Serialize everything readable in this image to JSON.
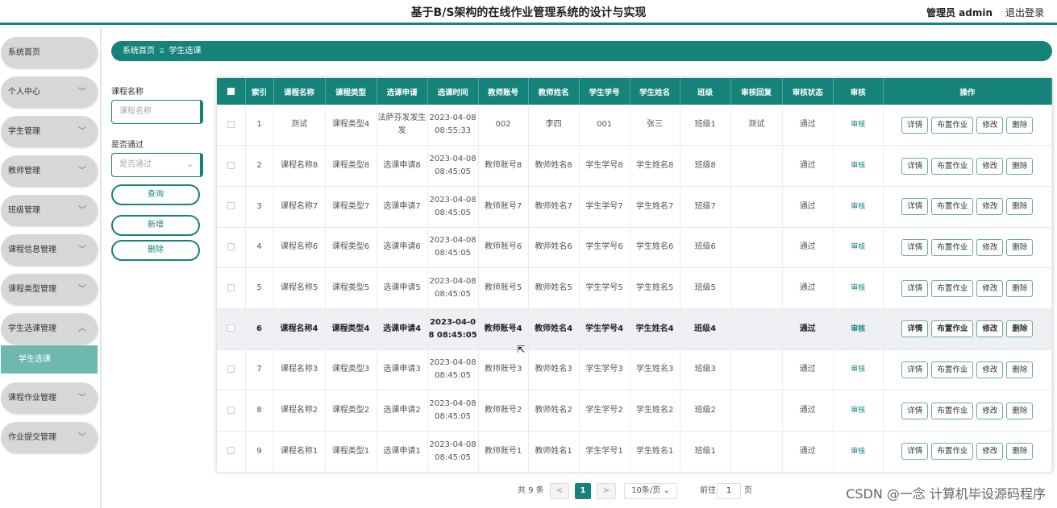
{
  "header": {
    "title": "基于B/S架构的在线作业管理系统的设计与实现",
    "user": "管理员 admin",
    "logout": "退出登录"
  },
  "sidebar": {
    "items": [
      {
        "label": "系统首页",
        "has_chevron": false
      },
      {
        "label": "个人中心",
        "has_chevron": true
      },
      {
        "label": "学生管理",
        "has_chevron": true
      },
      {
        "label": "教师管理",
        "has_chevron": true
      },
      {
        "label": "班级管理",
        "has_chevron": true
      },
      {
        "label": "课程信息管理",
        "has_chevron": true
      },
      {
        "label": "课程类型管理",
        "has_chevron": true
      },
      {
        "label": "学生选课管理",
        "has_chevron": true,
        "expanded": true
      },
      {
        "label": "课程作业管理",
        "has_chevron": true
      },
      {
        "label": "作业提交管理",
        "has_chevron": true
      }
    ],
    "subitem": "学生选课"
  },
  "breadcrumb": {
    "home": "系统首页",
    "current": "学生选课"
  },
  "filter": {
    "course_label": "课程名称",
    "course_placeholder": "课程名称",
    "approved_label": "是否通过",
    "approved_placeholder": "是否通过",
    "query": "查询",
    "add": "新增",
    "delete": "删除"
  },
  "table": {
    "columns": [
      "索引",
      "课程名称",
      "课程类型",
      "选课申请",
      "选课时间",
      "教师账号",
      "教师姓名",
      "学生学号",
      "学生姓名",
      "班级",
      "审核回复",
      "审核状态",
      "审核",
      "操作"
    ],
    "rows": [
      {
        "index": "1",
        "course": "测试",
        "type": "课程类型4",
        "apply": "法萨芬发发生发",
        "time": "2023-04-08 08:55:33",
        "tacc": "002",
        "tname": "李四",
        "sno": "001",
        "sname": "张三",
        "class": "班级1",
        "reply": "测试",
        "status": "通过"
      },
      {
        "index": "2",
        "course": "课程名称8",
        "type": "课程类型8",
        "apply": "选课申请8",
        "time": "2023-04-08 08:45:05",
        "tacc": "教师账号8",
        "tname": "教师姓名8",
        "sno": "学生学号8",
        "sname": "学生姓名8",
        "class": "班级8",
        "reply": "",
        "status": "通过"
      },
      {
        "index": "3",
        "course": "课程名称7",
        "type": "课程类型7",
        "apply": "选课申请7",
        "time": "2023-04-08 08:45:05",
        "tacc": "教师账号7",
        "tname": "教师姓名7",
        "sno": "学生学号7",
        "sname": "学生姓名7",
        "class": "班级7",
        "reply": "",
        "status": "通过"
      },
      {
        "index": "4",
        "course": "课程名称6",
        "type": "课程类型6",
        "apply": "选课申请6",
        "time": "2023-04-08 08:45:05",
        "tacc": "教师账号6",
        "tname": "教师姓名6",
        "sno": "学生学号6",
        "sname": "学生姓名6",
        "class": "班级6",
        "reply": "",
        "status": "通过"
      },
      {
        "index": "5",
        "course": "课程名称5",
        "type": "课程类型5",
        "apply": "选课申请5",
        "time": "2023-04-08 08:45:05",
        "tacc": "教师账号5",
        "tname": "教师姓名5",
        "sno": "学生学号5",
        "sname": "学生姓名5",
        "class": "班级5",
        "reply": "",
        "status": "通过"
      },
      {
        "index": "6",
        "course": "课程名称4",
        "type": "课程类型4",
        "apply": "选课申请4",
        "time": "2023-04-08 08:45:05",
        "tacc": "教师账号4",
        "tname": "教师姓名4",
        "sno": "学生学号4",
        "sname": "学生姓名4",
        "class": "班级4",
        "reply": "",
        "status": "通过",
        "highlight": true
      },
      {
        "index": "7",
        "course": "课程名称3",
        "type": "课程类型3",
        "apply": "选课申请3",
        "time": "2023-04-08 08:45:05",
        "tacc": "教师账号3",
        "tname": "教师姓名3",
        "sno": "学生学号3",
        "sname": "学生姓名3",
        "class": "班级3",
        "reply": "",
        "status": "通过"
      },
      {
        "index": "8",
        "course": "课程名称2",
        "type": "课程类型2",
        "apply": "选课申请2",
        "time": "2023-04-08 08:45:05",
        "tacc": "教师账号2",
        "tname": "教师姓名2",
        "sno": "学生学号2",
        "sname": "学生姓名2",
        "class": "班级2",
        "reply": "",
        "status": "通过"
      },
      {
        "index": "9",
        "course": "课程名称1",
        "type": "课程类型1",
        "apply": "选课申请1",
        "time": "2023-04-08 08:45:05",
        "tacc": "教师账号1",
        "tname": "教师姓名1",
        "sno": "学生学号1",
        "sname": "学生姓名1",
        "class": "班级1",
        "reply": "",
        "status": "通过"
      }
    ],
    "audit_label": "审核",
    "ops": [
      "详情",
      "布置作业",
      "修改",
      "删除"
    ]
  },
  "pagination": {
    "total": "共 9 条",
    "prev": "<",
    "page": "1",
    "next": ">",
    "size": "10条/页",
    "goto": "前往",
    "goto_value": "1",
    "page_unit": "页"
  },
  "watermark": "CSDN @一念 计算机毕设源码程序",
  "colors": {
    "accent": "#16837a"
  }
}
